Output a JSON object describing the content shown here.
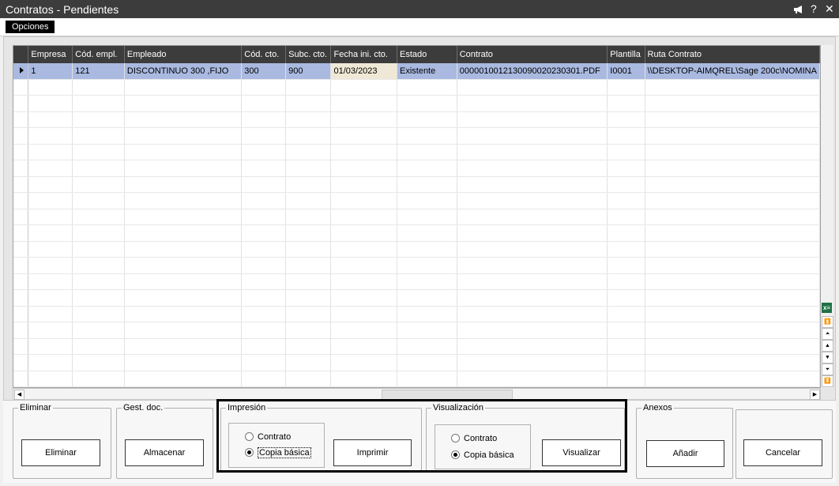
{
  "window": {
    "title": "Contratos - Pendientes",
    "controls": {
      "help": "?",
      "close": "✕"
    }
  },
  "menu": {
    "opciones": "Opciones"
  },
  "table": {
    "columns": [
      "Empresa",
      "Cód. empl.",
      "Empleado",
      "Cód. cto.",
      "Subc. cto.",
      "Fecha ini. cto.",
      "Estado",
      "Contrato",
      "Plantilla",
      "Ruta Contrato"
    ],
    "rows": [
      [
        "1",
        "121",
        "DISCONTINUO 300 ,FIJO",
        "300",
        "900",
        "01/03/2023",
        "Existente",
        "00000100121300900202303​01.PDF",
        "I0001",
        "\\\\DESKTOP-AIMQREL\\Sage 200c\\NOMINA"
      ]
    ]
  },
  "groups": {
    "eliminar": {
      "legend": "Eliminar",
      "button": "Eliminar"
    },
    "gest_doc": {
      "legend": "Gest. doc.",
      "button": "Almacenar"
    },
    "impresion": {
      "legend": "Impresión",
      "option_contrato": "Contrato",
      "option_copia": "Copia básica",
      "selected": "Copia básica",
      "button": "Imprimir"
    },
    "visualizacion": {
      "legend": "Visualización",
      "option_contrato": "Contrato",
      "option_copia": "Copia básica",
      "selected": "Copia básica",
      "button": "Visualizar"
    },
    "anexos": {
      "legend": "Anexos",
      "button": "Añadir"
    },
    "cancelar": {
      "button": "Cancelar"
    }
  },
  "icons": {
    "title_flag": "megaphone-icon",
    "excel": "excel-export-icon",
    "excel_glyph": "x≡"
  }
}
